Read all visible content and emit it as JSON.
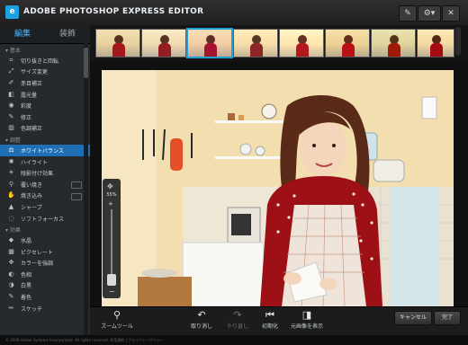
{
  "app": {
    "logo_letter": "e",
    "title": "ADOBE PHOTOSHOP EXPRESS EDITOR",
    "brand_color": "#1da1e0",
    "accent_color": "#2e9be8"
  },
  "window_controls": [
    "pen-icon",
    "gear-icon",
    "close-icon"
  ],
  "sidebar": {
    "tabs": [
      {
        "label": "編集",
        "active": true
      },
      {
        "label": "装飾",
        "active": false
      }
    ],
    "sections": [
      {
        "label": "基本",
        "items": [
          {
            "label": "切り抜きと回転",
            "icon": "crop-icon"
          },
          {
            "label": "サイズ変更",
            "icon": "resize-icon"
          },
          {
            "label": "赤目補正",
            "icon": "redeye-icon"
          },
          {
            "label": "露光量",
            "icon": "exposure-icon"
          },
          {
            "label": "彩度",
            "icon": "saturation-icon"
          },
          {
            "label": "修正",
            "icon": "brush-icon"
          },
          {
            "label": "色調補正",
            "icon": "tone-icon"
          }
        ]
      },
      {
        "label": "調整",
        "items": [
          {
            "label": "ホワイトバランス",
            "icon": "whitebalance-icon",
            "selected": true
          },
          {
            "label": "ハイライト",
            "icon": "highlight-icon"
          },
          {
            "label": "陰影付け効果",
            "icon": "fill-light-icon"
          },
          {
            "label": "覆い焼き",
            "icon": "dodge-icon"
          },
          {
            "label": "焼き込み",
            "icon": "burn-icon"
          },
          {
            "label": "シャープ",
            "icon": "sharpen-icon"
          },
          {
            "label": "ソフトフォーカス",
            "icon": "softfocus-icon"
          }
        ]
      },
      {
        "label": "効果",
        "items": [
          {
            "label": "水晶",
            "icon": "crystal-icon"
          },
          {
            "label": "ピクセレート",
            "icon": "pixelate-icon"
          },
          {
            "label": "カラーを強調",
            "icon": "pop-color-icon"
          },
          {
            "label": "色相",
            "icon": "hue-icon"
          },
          {
            "label": "白黒",
            "icon": "bw-icon"
          },
          {
            "label": "着色",
            "icon": "tint-icon"
          },
          {
            "label": "スケッチ",
            "icon": "sketch-icon"
          }
        ]
      }
    ]
  },
  "thumbnails": {
    "count": 8,
    "selected_index": 2
  },
  "zoom": {
    "value": "55%",
    "plus": "+",
    "minus": "−"
  },
  "bottom_toolbar": {
    "zoom_tool": "ズームツール",
    "undo": "取り消し",
    "redo": "やり直し",
    "reset": "初期化",
    "view_original": "元画像を表示"
  },
  "buttons": {
    "cancel": "キャンセル",
    "done": "完了"
  },
  "footer": "© 2008 Adobe Systems Incorporated. All rights reserved.   利用規約  |  プライバシーポリシー"
}
